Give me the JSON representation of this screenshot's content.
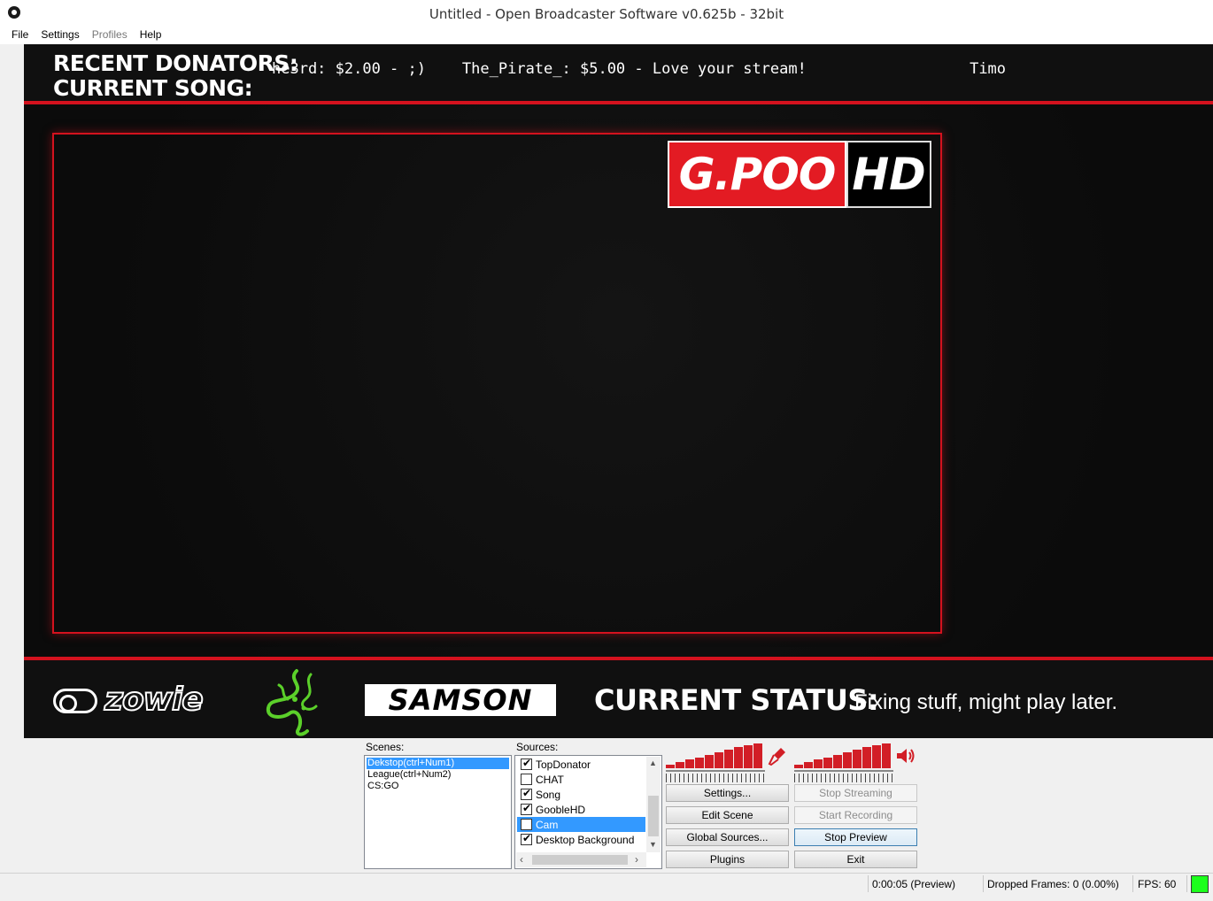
{
  "window": {
    "title": "Untitled - Open Broadcaster Software v0.625b - 32bit"
  },
  "menu": {
    "file": "File",
    "settings": "Settings",
    "profiles": "Profiles",
    "help": "Help"
  },
  "overlay": {
    "donators_label": "RECENT DONATORS:",
    "song_label": "CURRENT SONG:",
    "ticker_text": "he3rd: $2.00 - ;)    The_Pirate_: $5.00 - Love your stream!                  Timo",
    "logo_left": "G.POO",
    "logo_right": "HD",
    "sponsor_1": "zowie",
    "sponsor_3": "SAMSON",
    "status_label": "CURRENT STATUS:",
    "status_value": "Fixing stuff, might play later.",
    "accent_color": "#d4121e"
  },
  "scenes": {
    "label": "Scenes:",
    "items": [
      "Dekstop(ctrl+Num1)",
      "League(ctrl+Num2)",
      "CS:GO"
    ],
    "selected_index": 0
  },
  "sources": {
    "label": "Sources:",
    "items": [
      {
        "name": "TopDonator",
        "checked": true
      },
      {
        "name": "CHAT",
        "checked": false
      },
      {
        "name": "Song",
        "checked": true
      },
      {
        "name": "GoobleHD",
        "checked": true
      },
      {
        "name": "Cam",
        "checked": false
      },
      {
        "name": "Desktop Background",
        "checked": true
      }
    ],
    "selected_index": 4
  },
  "audio": {
    "mic_icon": "microphone-icon",
    "desktop_icon": "speaker-icon"
  },
  "buttons": {
    "settings": "Settings...",
    "edit_scene": "Edit Scene",
    "global_sources": "Global Sources...",
    "plugins": "Plugins",
    "stop_streaming": "Stop Streaming",
    "start_recording": "Start Recording",
    "stop_preview": "Stop Preview",
    "exit": "Exit"
  },
  "statusbar": {
    "time": "0:00:05 (Preview)",
    "dropped_frames": "Dropped Frames: 0 (0.00%)",
    "fps": "FPS: 60",
    "status_color": "#1cff1c"
  }
}
